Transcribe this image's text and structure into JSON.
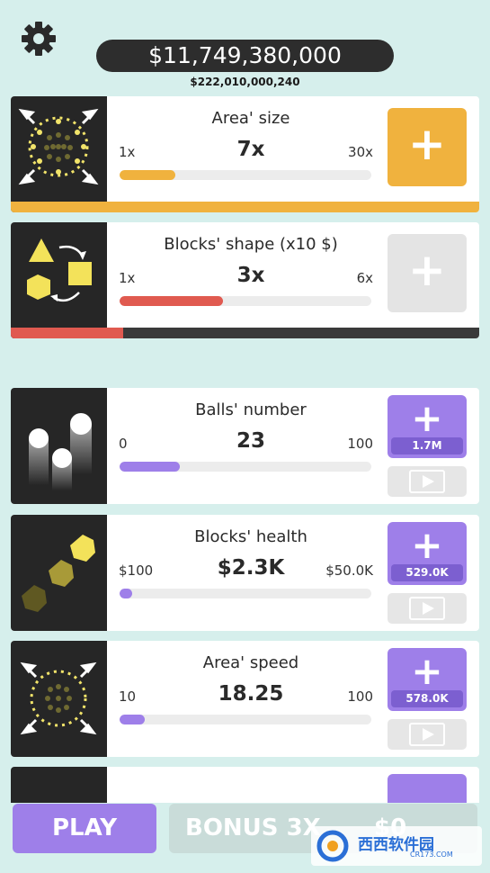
{
  "header": {
    "money": "$11,749,380,000",
    "sub_money": "$222,010,000,240"
  },
  "upgrades": [
    {
      "title": "Area' size",
      "min": "1x",
      "current": "7x",
      "max": "30x",
      "progress": 0.22,
      "bar_fill_color": "#f0b23e",
      "button_color": "#f0b23e",
      "icon": "area-expand-icon"
    },
    {
      "title": "Blocks' shape (x10 $)",
      "min": "1x",
      "current": "3x",
      "max": "6x",
      "progress": 0.41,
      "bar_fill_color": "#e05a50",
      "button_color": "#e4e4e4",
      "icon": "shapes-cycle-icon"
    }
  ],
  "stats": [
    {
      "title": "Balls' number",
      "min": "0",
      "current": "23",
      "max": "100",
      "progress": 0.24,
      "price": "1.7M",
      "icon": "balls-icon"
    },
    {
      "title": "Blocks' health",
      "min": "$100",
      "current": "$2.3K",
      "max": "$50.0K",
      "progress": 0.05,
      "price": "529.0K",
      "icon": "hexagons-icon"
    },
    {
      "title": "Area' speed",
      "min": "10",
      "current": "18.25",
      "max": "100",
      "progress": 0.1,
      "price": "578.0K",
      "icon": "area-speed-icon"
    }
  ],
  "footer": {
    "play_label": "PLAY",
    "bonus_label": "BONUS 3X",
    "bonus_value": "$0"
  },
  "watermark": {
    "text": "西西软件园",
    "sub": "CR173.COM"
  },
  "colors": {
    "background": "#d6efec",
    "purple": "#9e7fe9",
    "orange": "#f0b23e",
    "red": "#e05a50",
    "dark": "#262626"
  }
}
